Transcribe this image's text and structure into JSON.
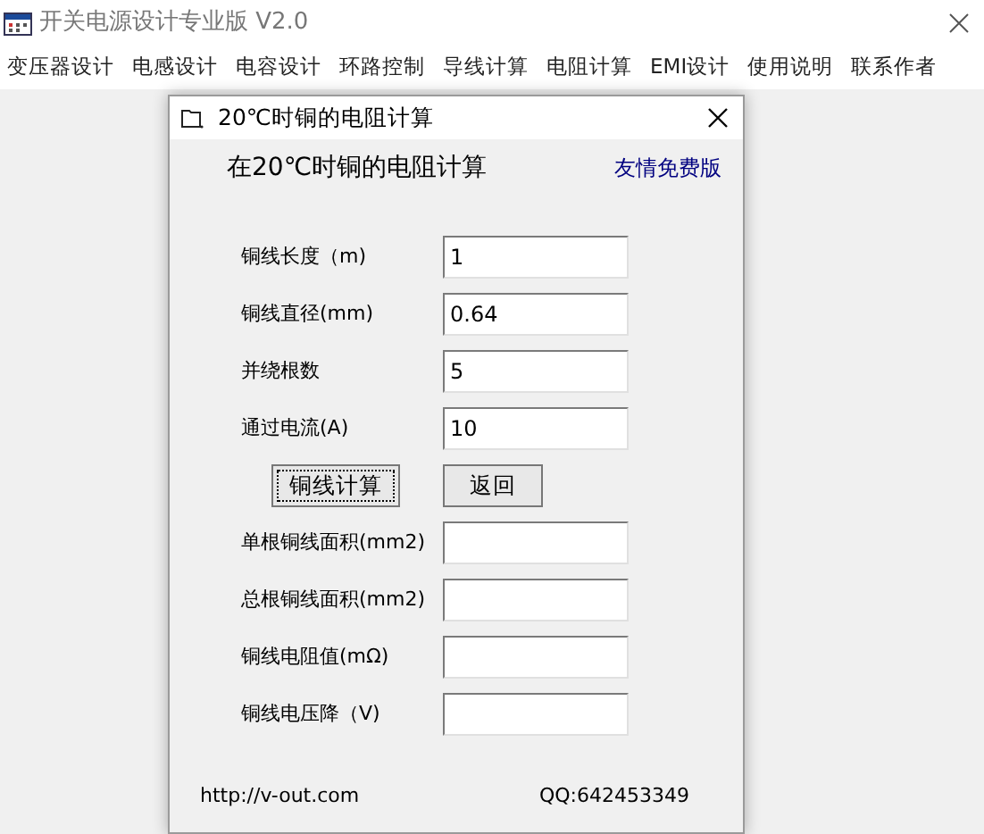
{
  "window": {
    "title": "开关电源设计专业版  V2.0"
  },
  "menu": [
    "变压器设计",
    "电感设计",
    "电容设计",
    "环路控制",
    "导线计算",
    "电阻计算",
    "EMI设计",
    "使用说明",
    "联系作者"
  ],
  "dialog": {
    "title": "20℃时铜的电阻计算",
    "heading": "在20℃时铜的电阻计算",
    "edition": "友情免费版",
    "inputs": [
      {
        "label": "铜线长度（m)",
        "value": "1"
      },
      {
        "label": "铜线直径(mm)",
        "value": "0.64"
      },
      {
        "label": "并绕根数",
        "value": "5"
      },
      {
        "label": "通过电流(A)",
        "value": "10"
      }
    ],
    "buttons": [
      {
        "label": "铜线计算",
        "focused": true
      },
      {
        "label": "返回",
        "focused": false
      }
    ],
    "outputs": [
      {
        "label": "单根铜线面积(mm2)"
      },
      {
        "label": "总根铜线面积(mm2)"
      },
      {
        "label": "铜线电阻值(mΩ)"
      },
      {
        "label": "铜线电压降（V)"
      }
    ],
    "website": "http://v-out.com",
    "qq": "QQ:642453349"
  }
}
